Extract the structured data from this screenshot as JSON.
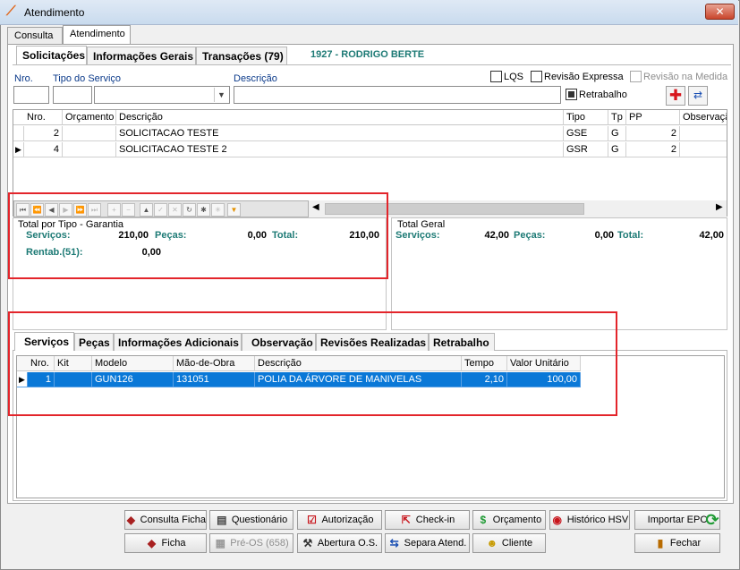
{
  "window": {
    "title": "Atendimento",
    "close_label": "✕"
  },
  "top_tabs": [
    {
      "label": "Consulta"
    },
    {
      "label": "Atendimento"
    }
  ],
  "subtabs": [
    {
      "label": "Solicitações"
    },
    {
      "label": "Informações Gerais"
    },
    {
      "label": "Transações (79)"
    }
  ],
  "client": {
    "name": "1927 - RODRIGO BERTE"
  },
  "form": {
    "nro_label": "Nro.",
    "tipo_label": "Tipo do Serviço",
    "descricao_label": "Descrição",
    "nro_value": "",
    "tipo_value": "",
    "descricao_value": "",
    "lqs_label": "LQS",
    "revisao_expressa_label": "Revisão Expressa",
    "revisao_medida_label": "Revisão na Medida",
    "retrabalho_label": "Retrabalho"
  },
  "requests_table": {
    "columns": [
      "Nro.",
      "Orçamento",
      "Descrição",
      "Tipo",
      "Tp",
      "PP",
      "Observação"
    ],
    "rows": [
      {
        "nro": "2",
        "orcamento": "",
        "descricao": "SOLICITACAO TESTE",
        "tipo": "GSE",
        "tp": "G",
        "pp": "2",
        "obs": "",
        "current": false
      },
      {
        "nro": "4",
        "orcamento": "",
        "descricao": "SOLICITACAO TESTE 2",
        "tipo": "GSR",
        "tp": "G",
        "pp": "2",
        "obs": "",
        "current": true
      }
    ]
  },
  "nav_icons": [
    "first-icon",
    "prev-page-icon",
    "prev-icon",
    "next-icon",
    "next-page-icon",
    "last-icon",
    "insert-icon",
    "delete-icon",
    "edit-icon",
    "post-icon",
    "cancel-icon",
    "refresh-icon",
    "apply-filter-icon",
    "clear-filter-icon",
    "filter-icon"
  ],
  "totals_tipo": {
    "title": "Total por Tipo - Garantia",
    "servicos_label": "Serviços:",
    "servicos_value": "210,00",
    "pecas_label": "Peças:",
    "pecas_value": "0,00",
    "total_label": "Total:",
    "total_value": "210,00",
    "rentab_label": "Rentab.(51):",
    "rentab_value": "0,00"
  },
  "totals_geral": {
    "title": "Total Geral",
    "servicos_label": "Serviços:",
    "servicos_value": "42,00",
    "pecas_label": "Peças:",
    "pecas_value": "0,00",
    "total_label": "Total:",
    "total_value": "42,00"
  },
  "lower_tabs": [
    {
      "label": "Serviços"
    },
    {
      "label": "Peças"
    },
    {
      "label": "Informações Adicionais"
    },
    {
      "label": "Observação"
    },
    {
      "label": "Revisões Realizadas"
    },
    {
      "label": "Retrabalho"
    }
  ],
  "services_table": {
    "columns": [
      "Nro.",
      "Kit",
      "Modelo",
      "Mão-de-Obra",
      "Descrição",
      "Tempo",
      "Valor Unitário"
    ],
    "rows": [
      {
        "nro": "1",
        "kit": "",
        "modelo": "GUN126",
        "mao": "131051",
        "descricao": "POLIA DA ÁRVORE DE MANIVELAS",
        "tempo": "2,10",
        "valor": "100,00"
      }
    ]
  },
  "buttons": {
    "consulta_ficha": "Consulta Ficha",
    "questionario": "Questionário",
    "autorizacao": "Autorização",
    "check_in": "Check-in",
    "orcamento": "Orçamento",
    "historico_hsv": "Histórico HSV",
    "importar_epc": "Importar EPC",
    "ficha": "Ficha",
    "pre_os": "Pré-OS (658)",
    "abertura_os": "Abertura O.S.",
    "separa_atend": "Separa Atend.",
    "cliente": "Cliente",
    "fechar": "Fechar"
  },
  "colors": {
    "accent_teal": "#1d7a75",
    "selection": "#0a78d7",
    "highlight_box": "#e3252b"
  }
}
